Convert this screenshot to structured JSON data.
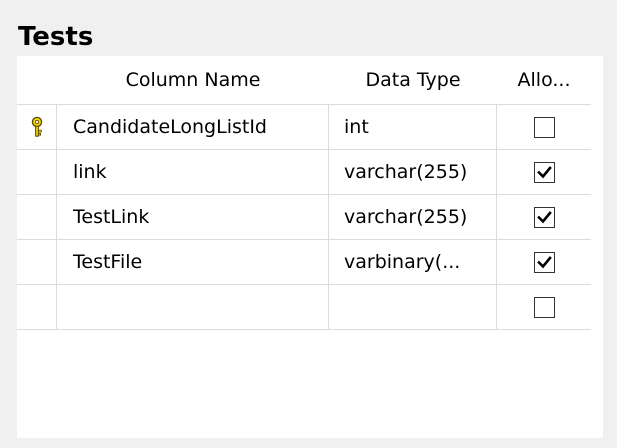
{
  "table": {
    "title": "Tests",
    "columns": {
      "name": "Column Name",
      "type": "Data Type",
      "allow_nulls": "Allo..."
    },
    "rows": [
      {
        "name": "CandidateLongListId",
        "type": "int",
        "allow_nulls": false,
        "primary_key": true
      },
      {
        "name": "link",
        "type": "varchar(255)",
        "allow_nulls": true,
        "primary_key": false
      },
      {
        "name": "TestLink",
        "type": "varchar(255)",
        "allow_nulls": true,
        "primary_key": false
      },
      {
        "name": "TestFile",
        "type": "varbinary(...",
        "allow_nulls": true,
        "primary_key": false
      },
      {
        "name": "",
        "type": "",
        "allow_nulls": false,
        "primary_key": false
      }
    ]
  },
  "icons": {
    "primary_key": "key-icon",
    "checked": "checkmark-icon"
  },
  "colors": {
    "background": "#f0f0f0",
    "grid_background": "#ffffff",
    "gridline": "#dcdcdc",
    "key_icon": "#f2d500"
  }
}
